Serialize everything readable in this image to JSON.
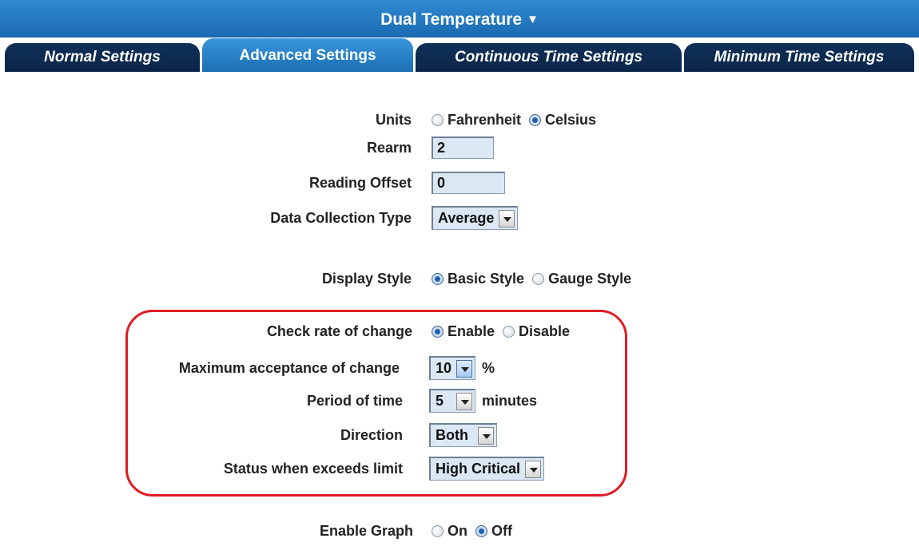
{
  "header": {
    "title": "Dual Temperature",
    "arrow": "▼"
  },
  "tabs": [
    {
      "label": "Normal Settings",
      "active": false
    },
    {
      "label": "Advanced Settings",
      "active": true
    },
    {
      "label": "Continuous Time Settings",
      "active": false
    },
    {
      "label": "Minimum Time Settings",
      "active": false
    }
  ],
  "form": {
    "units": {
      "label": "Units",
      "options": [
        "Fahrenheit",
        "Celsius"
      ],
      "selected": "Celsius"
    },
    "rearm": {
      "label": "Rearm",
      "value": "2"
    },
    "reading_offset": {
      "label": "Reading Offset",
      "value": "0"
    },
    "data_collection_type": {
      "label": "Data Collection Type",
      "value": "Average"
    },
    "display_style": {
      "label": "Display Style",
      "options": [
        "Basic Style",
        "Gauge Style"
      ],
      "selected": "Basic Style"
    },
    "check_rate": {
      "label": "Check rate of change",
      "options": [
        "Enable",
        "Disable"
      ],
      "selected": "Enable"
    },
    "max_acceptance": {
      "label": "Maximum acceptance of change",
      "value": "10",
      "suffix": "%"
    },
    "period": {
      "label": "Period of time",
      "value": "5",
      "suffix": "minutes"
    },
    "direction": {
      "label": "Direction",
      "value": "Both"
    },
    "status_exceeds": {
      "label": "Status when exceeds limit",
      "value": "High Critical"
    },
    "enable_graph": {
      "label": "Enable Graph",
      "options": [
        "On",
        "Off"
      ],
      "selected": "Off"
    }
  },
  "colors": {
    "header_blue": "#1f74bf",
    "tab_dark": "#0d2b50",
    "field_bg": "#dbe8f4",
    "highlight_red": "#e01b24"
  }
}
